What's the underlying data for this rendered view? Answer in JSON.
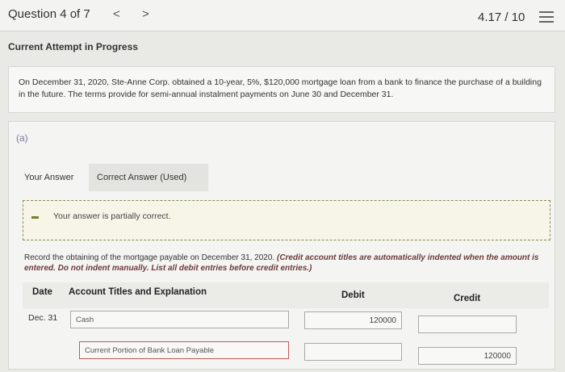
{
  "topbar": {
    "question_label": "Question 4 of 7",
    "prev_glyph": "<",
    "next_glyph": ">",
    "score": "4.17 / 10"
  },
  "attempt_title": "Current Attempt in Progress",
  "problem_text": "On December 31, 2020, Ste-Anne Corp. obtained a 10-year, 5%, $120,000 mortgage loan from a bank to finance the purchase of a building in the future. The terms provide for semi-annual instalment payments on June 30 and December 31.",
  "part": {
    "label": "(a)",
    "tabs": {
      "your_answer": "Your Answer",
      "correct_answer": "Correct Answer (Used)"
    },
    "feedback": "Your answer is partially correct.",
    "instruction_plain": "Record the obtaining of the mortgage payable on December 31, 2020. ",
    "instruction_emph": "(Credit account titles are automatically indented when the amount is entered. Do not indent manually. List all debit entries before credit entries.)"
  },
  "journal": {
    "headers": {
      "date": "Date",
      "account": "Account Titles and Explanation",
      "debit": "Debit",
      "credit": "Credit"
    },
    "rows": [
      {
        "date": "Dec. 31",
        "account": "Cash",
        "debit": "120000",
        "credit": ""
      },
      {
        "date": "",
        "account": "Current Portion of Bank Loan Payable",
        "debit": "",
        "credit": "120000"
      }
    ]
  }
}
